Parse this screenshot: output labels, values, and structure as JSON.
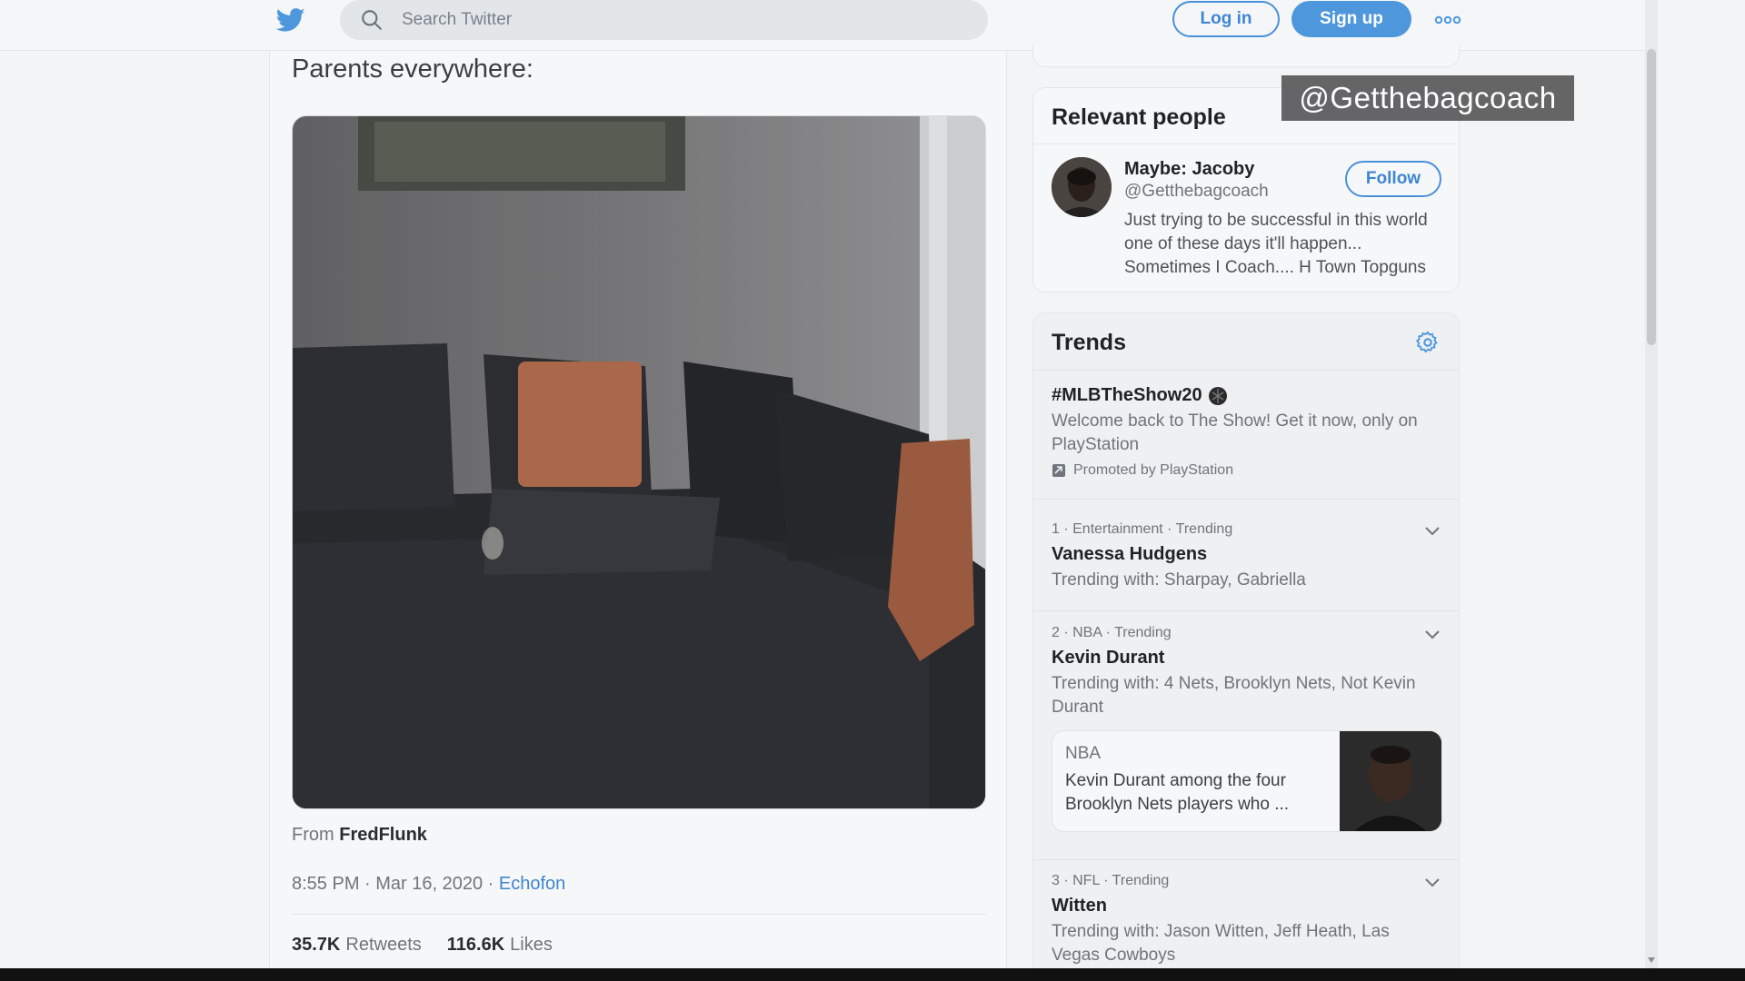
{
  "header": {
    "search_placeholder": "Search Twitter",
    "login_label": "Log in",
    "signup_label": "Sign up",
    "brand_color": "#4e97dd"
  },
  "tweet": {
    "text": "Parents everywhere:",
    "from_prefix": "From",
    "from_user": "FredFlunk",
    "timestamp": "8:55 PM · Mar 16, 2020 ·",
    "source_app": "Echofon",
    "retweets_count": "35.7K",
    "retweets_label": "Retweets",
    "likes_count": "116.6K",
    "likes_label": "Likes"
  },
  "overlay": {
    "handle_caption": "@Getthebagcoach"
  },
  "relevant_people": {
    "heading": "Relevant people",
    "person": {
      "name": "Maybe: Jacoby",
      "handle": "@Getthebagcoach",
      "bio": "Just trying to be successful in this world one of these days it'll happen... Sometimes I Coach.... H Town Topguns",
      "follow_label": "Follow"
    }
  },
  "trends": {
    "heading": "Trends",
    "promoted": {
      "title": "#MLBTheShow20",
      "description": "Welcome back to The Show! Get it now, only on PlayStation",
      "promoted_by": "Promoted by PlayStation"
    },
    "items": [
      {
        "meta": "1 · Entertainment · Trending",
        "title": "Vanessa Hudgens",
        "subtitle": "Trending with: Sharpay, Gabriella"
      },
      {
        "meta": "2 · NBA · Trending",
        "title": "Kevin Durant",
        "subtitle": "Trending with: 4 Nets, Brooklyn Nets, Not Kevin Durant",
        "news": {
          "source": "NBA",
          "headline": "Kevin Durant among the four Brooklyn Nets players who ..."
        }
      },
      {
        "meta": "3 · NFL · Trending",
        "title": "Witten",
        "subtitle": "Trending with: Jason Witten, Jeff Heath, Las Vegas Cowboys"
      }
    ]
  }
}
